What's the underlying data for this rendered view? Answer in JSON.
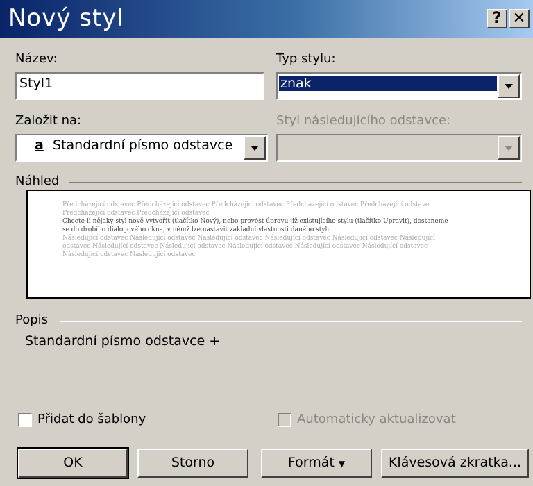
{
  "window": {
    "title": "Nový styl",
    "help_label": "?",
    "close_label": "✕"
  },
  "name_field": {
    "label": "Název:",
    "value": "Styl1"
  },
  "style_type": {
    "label": "Typ stylu:",
    "value": "znak"
  },
  "based_on": {
    "label": "Založit na:",
    "icon": "a",
    "value": "Standardní písmo odstavce"
  },
  "next_style": {
    "label": "Styl následujícího odstavce:",
    "value": ""
  },
  "preview": {
    "label": "Náhled",
    "preceding_text": "Předcházející odstavec Předcházející odstavec Předcházející odstavec Předcházející odstavec Předcházející odstavec Předcházející odstavec Předcházející odstavec",
    "sample_text": "Chcete-li nějaký styl nově vytvořit (tlačítko Nový), nebo provést úpravu již existujícího stylu (tlačítko Upravit), dostaneme se do drobího dialogového okna, v němž lze nastavit základní vlastnosti daného stylu.",
    "following_text": "Následující odstavec Následující odstavec Následující odstavec Následující odstavec Následující odstavec Následující odstavec Následující odstavec Následující odstavec Následující odstavec Následující odstavec Následující odstavec Následující odstavec Následující odstavec"
  },
  "description": {
    "label": "Popis",
    "text": "Standardní písmo odstavce +"
  },
  "add_to_template": {
    "label": "Přidat do šablony",
    "checked": false
  },
  "auto_update": {
    "label": "Automaticky aktualizovat",
    "checked": false
  },
  "buttons": {
    "ok": "OK",
    "cancel": "Storno",
    "format": "Formát",
    "shortcut": "Klávesová zkratka..."
  }
}
